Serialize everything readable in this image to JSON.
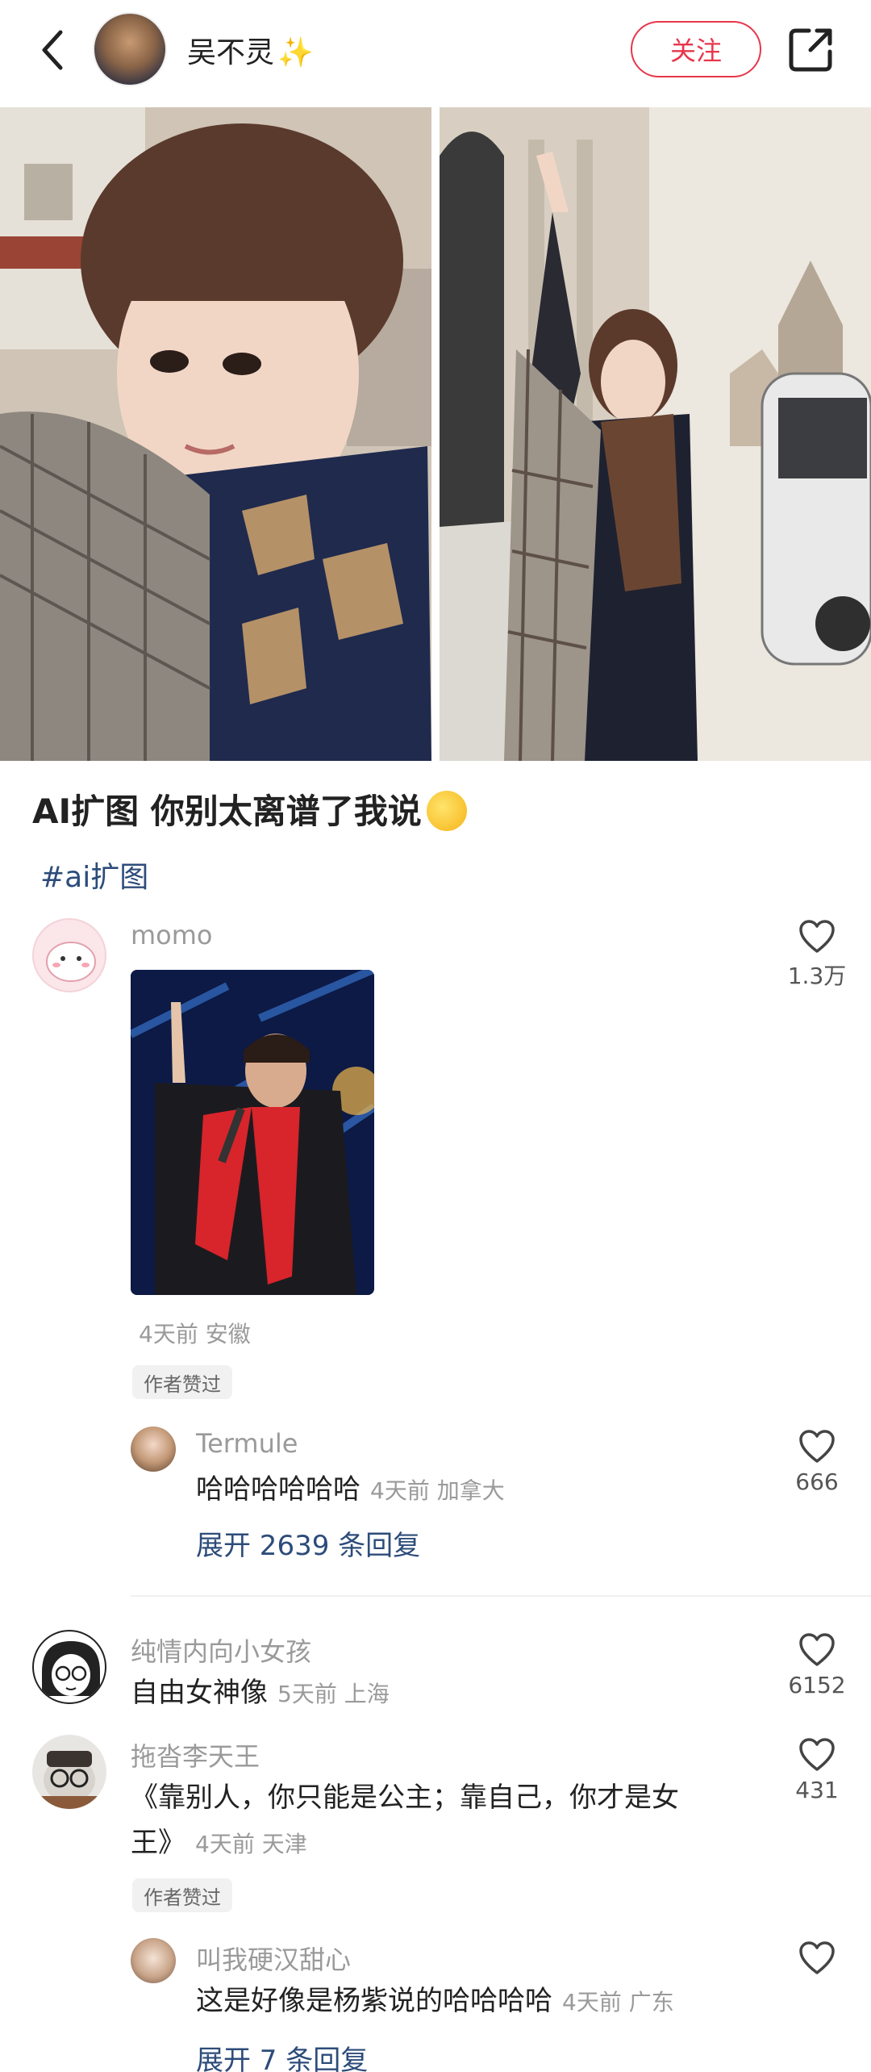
{
  "header": {
    "author_name": "吴不灵",
    "sparkle": "✨",
    "follow_label": "关注"
  },
  "post": {
    "title": "AI扩图  你别太离谱了我说",
    "hashtag": "#ai扩图"
  },
  "comments": [
    {
      "name": "momo",
      "likes": "1.3万",
      "meta": "4天前  安徽",
      "badge": "作者赞过",
      "reply": {
        "name": "Termule",
        "text": "哈哈哈哈哈哈",
        "meta": "4天前  加拿大",
        "likes": "666"
      },
      "expand_label": "展开 2639 条回复"
    },
    {
      "name": "纯情内向小女孩",
      "text": "自由女神像",
      "meta": "5天前  上海",
      "likes": "6152"
    },
    {
      "name": "拖沓李天王",
      "text_line1": "《靠别人，你只能是公主；靠自己，你才是女",
      "text_line2": "王》",
      "meta": "4天前  天津",
      "likes": "431",
      "badge": "作者赞过",
      "reply": {
        "name": "叫我硬汉甜心",
        "text": "这是好像是杨紫说的哈哈哈哈",
        "meta": "4天前  广东"
      },
      "expand_label": "展开 7 条回复"
    }
  ],
  "colors": {
    "accent": "#e8364b",
    "link": "#2d4c7a"
  },
  "icons": {
    "back": "chevron-left-icon",
    "share": "share-icon",
    "like": "heart-icon"
  }
}
